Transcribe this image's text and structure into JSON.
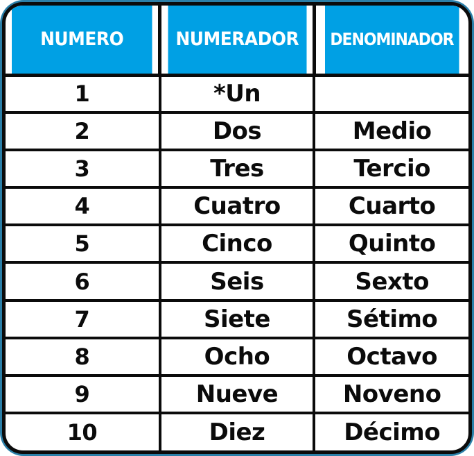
{
  "colors": {
    "header_blue": "#00a0e4",
    "backing_blue": "#2b7fa8",
    "border_black": "#0b0b0b",
    "cell_background": "#ffffff",
    "header_text": "#ffffff",
    "body_text": "#0b0b0b"
  },
  "table": {
    "headers": [
      {
        "label": "NUMERO"
      },
      {
        "label": "NUMERADOR"
      },
      {
        "label": "DENOMINADOR"
      }
    ],
    "rows": [
      {
        "numero": "1",
        "numerador": "*Un",
        "denominador": ""
      },
      {
        "numero": "2",
        "numerador": "Dos",
        "denominador": "Medio"
      },
      {
        "numero": "3",
        "numerador": "Tres",
        "denominador": "Tercio"
      },
      {
        "numero": "4",
        "numerador": "Cuatro",
        "denominador": "Cuarto"
      },
      {
        "numero": "5",
        "numerador": "Cinco",
        "denominador": "Quinto"
      },
      {
        "numero": "6",
        "numerador": "Seis",
        "denominador": "Sexto"
      },
      {
        "numero": "7",
        "numerador": "Siete",
        "denominador": "Sétimo"
      },
      {
        "numero": "8",
        "numerador": "Ocho",
        "denominador": "Octavo"
      },
      {
        "numero": "9",
        "numerador": "Nueve",
        "denominador": "Noveno"
      },
      {
        "numero": "10",
        "numerador": "Diez",
        "denominador": "Décimo"
      }
    ]
  }
}
